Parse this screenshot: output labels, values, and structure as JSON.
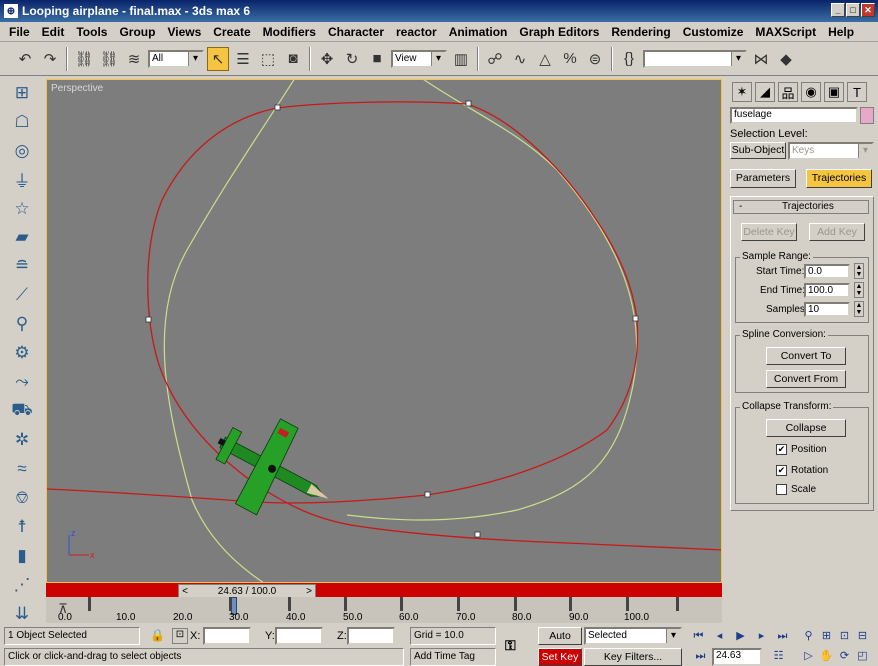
{
  "window": {
    "title": "Looping airplane - final.max - 3ds max 6",
    "app_icon": "3ds-max-icon"
  },
  "menu": [
    "File",
    "Edit",
    "Tools",
    "Group",
    "Views",
    "Create",
    "Modifiers",
    "Character",
    "reactor",
    "Animation",
    "Graph Editors",
    "Rendering",
    "Customize",
    "MAXScript",
    "Help"
  ],
  "toolbar": {
    "filter_value": "All",
    "refcoord_value": "View",
    "named_sel_value": ""
  },
  "viewport": {
    "label": "Perspective"
  },
  "time": {
    "slider_label": "24.63 / 100.0",
    "slider_prev": "<",
    "slider_next": ">",
    "ruler_labels": [
      "0.0",
      "10.0",
      "20.0",
      "30.0",
      "40.0",
      "50.0",
      "60.0",
      "70.0",
      "80.0",
      "90.0",
      "100.0"
    ]
  },
  "panel": {
    "object_name": "fuselage",
    "selection_level_label": "Selection Level:",
    "subobject_label": "Sub-Object",
    "subobject_value": "Keys",
    "tab_parameters": "Parameters",
    "tab_trajectories": "Trajectories",
    "rollout_toggle": "-",
    "rollout_title": "Trajectories",
    "delete_key": "Delete Key",
    "add_key": "Add Key",
    "sample_range_label": "Sample Range:",
    "start_time_label": "Start Time:",
    "start_time_value": "0.0",
    "end_time_label": "End Time:",
    "end_time_value": "100.0",
    "samples_label": "Samples:",
    "samples_value": "10",
    "spline_conversion_label": "Spline Conversion:",
    "convert_to": "Convert To",
    "convert_from": "Convert From",
    "collapse_transform_label": "Collapse Transform:",
    "collapse": "Collapse",
    "position_label": "Position",
    "rotation_label": "Rotation",
    "scale_label": "Scale",
    "check_mark": "✔"
  },
  "status": {
    "selection": "1 Object Selected",
    "prompt": "Click or click-and-drag to select objects",
    "x_label": "X:",
    "y_label": "Y:",
    "z_label": "Z:",
    "grid": "Grid = 10.0",
    "add_time_tag": "Add Time Tag",
    "auto_key": "Auto Key",
    "selected_value": "Selected",
    "set_key": "Set Key",
    "key_filters": "Key Filters...",
    "current_frame": "24.63"
  }
}
